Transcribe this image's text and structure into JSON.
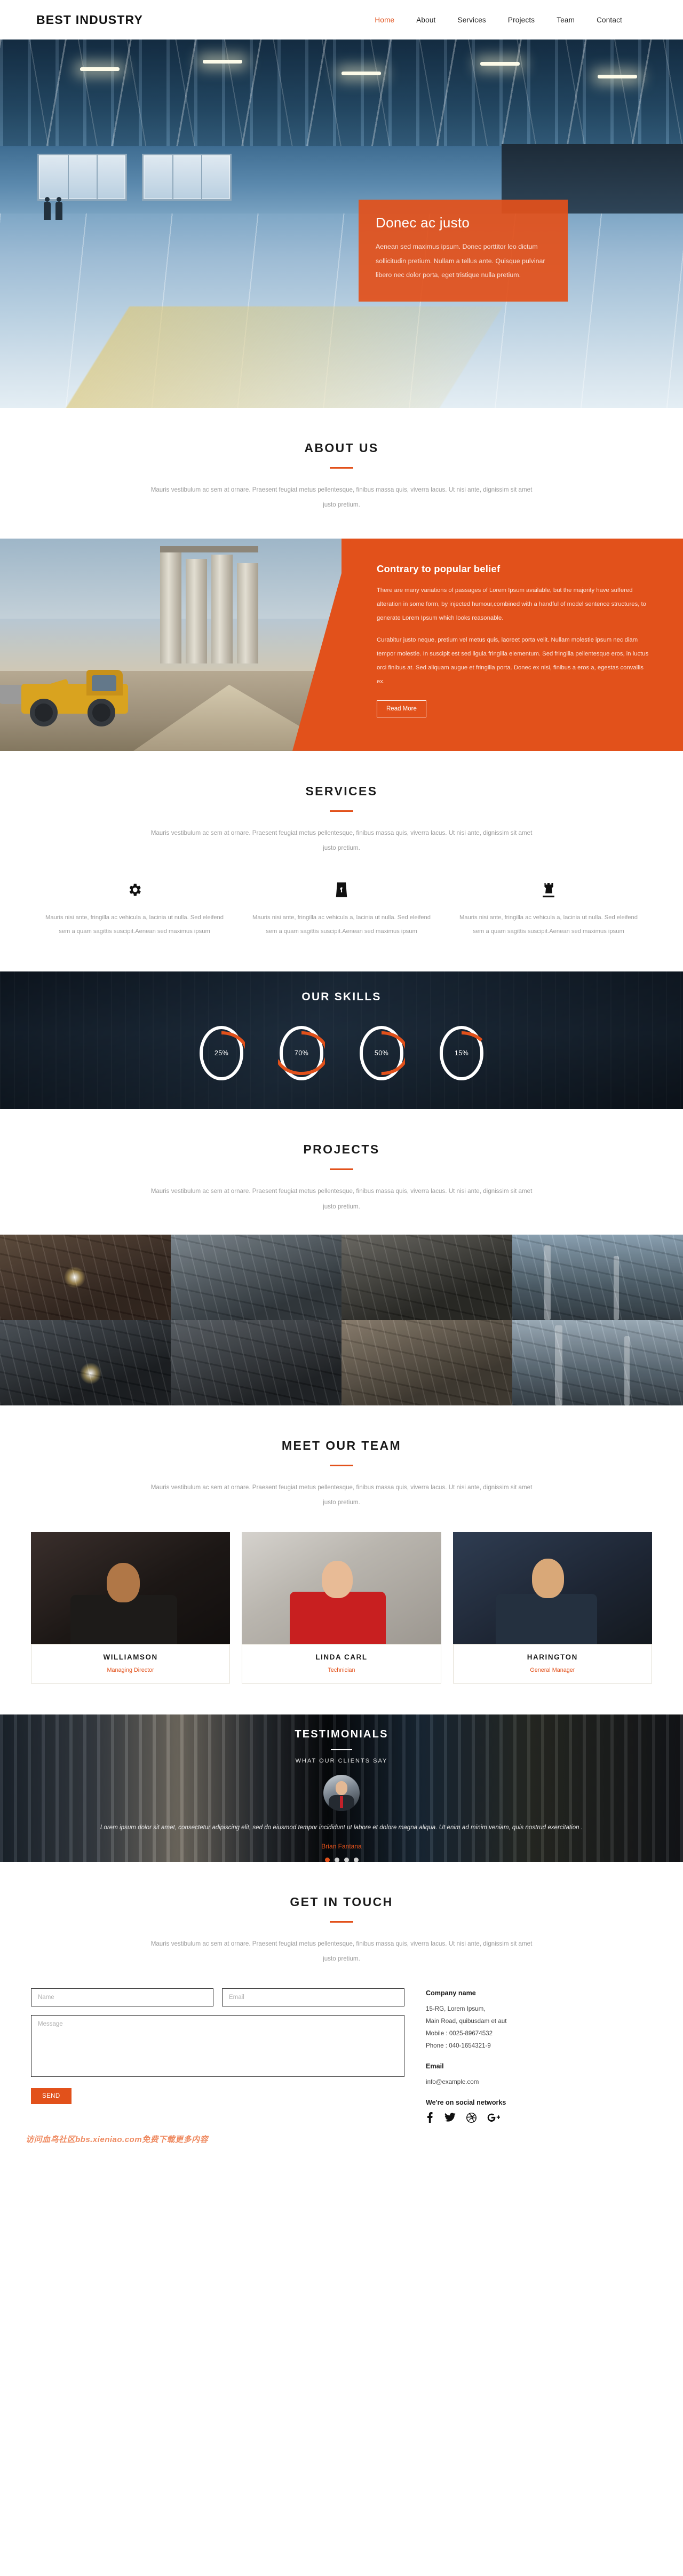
{
  "header": {
    "brand": "BEST INDUSTRY",
    "nav": [
      {
        "label": "Home",
        "active": true
      },
      {
        "label": "About",
        "active": false
      },
      {
        "label": "Services",
        "active": false
      },
      {
        "label": "Projects",
        "active": false
      },
      {
        "label": "Team",
        "active": false
      },
      {
        "label": "Contact",
        "active": false
      }
    ]
  },
  "hero": {
    "card_title": "Donec ac justo",
    "card_text": "Aenean sed maximus ipsum. Donec porttitor leo dictum sollicitudin pretium. Nullam a tellus ante. Quisque pulvinar libero nec dolor porta, eget tristique nulla pretium."
  },
  "about": {
    "title": "ABOUT US",
    "desc": "Mauris vestibulum ac sem at ornare. Praesent feugiat metus pellentesque, finibus massa quis, viverra lacus. Ut nisi ante, dignissim sit amet justo pretium.",
    "panel_title": "Contrary to popular belief",
    "panel_p1": "There are many variations of passages of Lorem Ipsum available, but the majority have suffered alteration in some form, by injected humour,combined with a handful of model sentence structures, to generate Lorem Ipsum which looks reasonable.",
    "panel_p2": "Curabitur justo neque, pretium vel metus quis, laoreet porta velit. Nullam molestie ipsum nec diam tempor molestie. In suscipit est sed ligula fringilla elementum. Sed fringilla pellentesque eros, in luctus orci finibus at. Sed aliquam augue et fringilla porta. Donec ex nisi, finibus a eros a, egestas convallis ex.",
    "read_more": "Read More"
  },
  "services": {
    "title": "SERVICES",
    "desc": "Mauris vestibulum ac sem at ornare. Praesent feugiat metus pellentesque, finibus massa quis, viverra lacus. Ut nisi ante, dignissim sit amet justo pretium.",
    "items": [
      {
        "icon": "gear-icon",
        "text": "Mauris nisi ante, fringilla ac vehicula a, lacinia ut nulla. Sed eleifend sem a quam sagittis suscipit.Aenean sed maximus ipsum"
      },
      {
        "icon": "bag-icon",
        "text": "Mauris nisi ante, fringilla ac vehicula a, lacinia ut nulla. Sed eleifend sem a quam sagittis suscipit.Aenean sed maximus ipsum"
      },
      {
        "icon": "rook-icon",
        "text": "Mauris nisi ante, fringilla ac vehicula a, lacinia ut nulla. Sed eleifend sem a quam sagittis suscipit.Aenean sed maximus ipsum"
      }
    ]
  },
  "skills": {
    "title": "OUR SKILLS",
    "items": [
      {
        "label": "25%",
        "value": 25
      },
      {
        "label": "70%",
        "value": 70
      },
      {
        "label": "50%",
        "value": 50
      },
      {
        "label": "15%",
        "value": 15
      }
    ]
  },
  "projects": {
    "title": "PROJECTS",
    "desc": "Mauris vestibulum ac sem at ornare. Praesent feugiat metus pellentesque, finibus massa quis, viverra lacus. Ut nisi ante, dignissim sit amet justo pretium."
  },
  "team": {
    "title": "MEET OUR TEAM",
    "desc": "Mauris vestibulum ac sem at ornare. Praesent feugiat metus pellentesque, finibus massa quis, viverra lacus. Ut nisi ante, dignissim sit amet justo pretium.",
    "members": [
      {
        "name": "WILLIAMSON",
        "role": "Managing Director"
      },
      {
        "name": "LINDA CARL",
        "role": "Technician"
      },
      {
        "name": "HARINGTON",
        "role": "General Manager"
      }
    ]
  },
  "testimonials": {
    "title": "TESTIMONIALS",
    "subtitle": "WHAT OUR CLIENTS SAY",
    "quote": "Lorem ipsum dolor sit amet, consectetur adipiscing elit, sed do eiusmod tempor incididunt ut labore et dolore magna aliqua. Ut enim ad minim veniam, quis nostrud exercitation .",
    "author": "Brian Fantana",
    "dots": 4,
    "active_dot": 0
  },
  "contact": {
    "title": "GET IN TOUCH",
    "desc": "Mauris vestibulum ac sem at ornare. Praesent feugiat metus pellentesque, finibus massa quis, viverra lacus. Ut nisi ante, dignissim sit amet justo pretium.",
    "name_placeholder": "Name",
    "email_placeholder": "Email",
    "message_placeholder": "Message",
    "send_label": "SEND",
    "company_heading": "Company name",
    "address_line1": "15-RG, Lorem Ipsum,",
    "address_line2": "Main Road, quibusdam et aut",
    "mobile": "Mobile : 0025-89674532",
    "phone": "Phone : 040-1654321-9",
    "email_heading": "Email",
    "email_value": "info@example.com",
    "social_heading": "We're on social networks",
    "socials": [
      "facebook-icon",
      "twitter-icon",
      "dribbble-icon",
      "google-plus-icon"
    ]
  },
  "watermark": "访问血鸟社区bbs.xieniao.com免费下载更多内容",
  "colors": {
    "accent": "#e2511b",
    "dark": "#111111",
    "muted": "#9a9a9a"
  }
}
